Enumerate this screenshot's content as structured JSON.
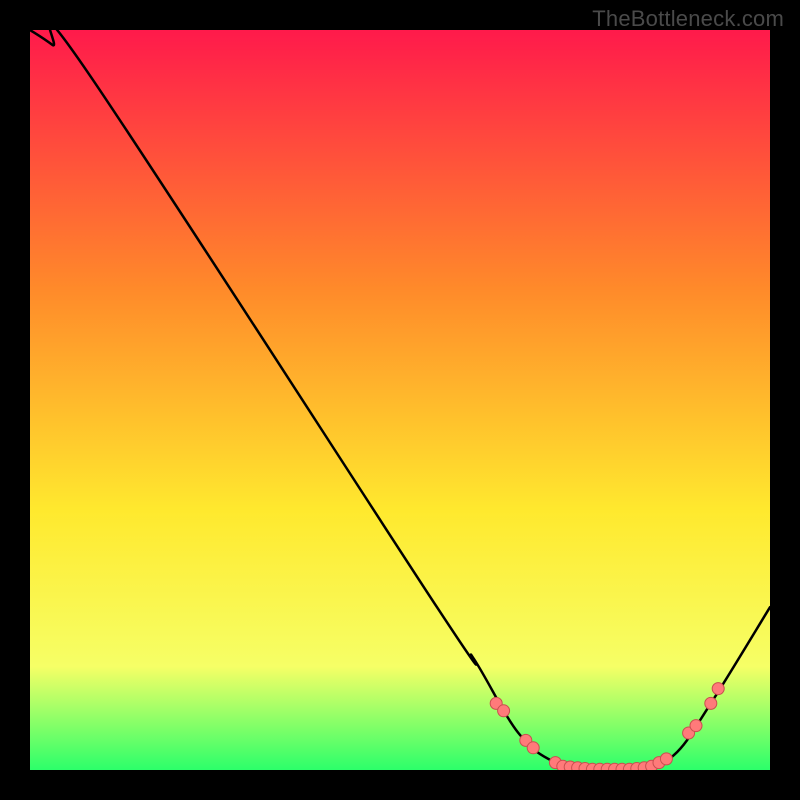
{
  "watermark": "TheBottleneck.com",
  "colors": {
    "frame": "#000000",
    "watermark_text": "#4a4a4a",
    "bg_top": "#ff1a4b",
    "bg_mid1": "#ff8a2a",
    "bg_mid2": "#ffe92e",
    "bg_mid3": "#f6ff66",
    "bg_bot": "#2cff6a",
    "curve": "#000000",
    "dot_fill": "#ff7a7a",
    "dot_stroke": "#c94f4f"
  },
  "chart_data": {
    "type": "line",
    "title": "",
    "xlabel": "",
    "ylabel": "",
    "xlim": [
      0,
      100
    ],
    "ylim": [
      0,
      100
    ],
    "grid": false,
    "curve": [
      {
        "x": 0,
        "y": 100
      },
      {
        "x": 3,
        "y": 98
      },
      {
        "x": 8,
        "y": 94
      },
      {
        "x": 55,
        "y": 22
      },
      {
        "x": 60,
        "y": 15
      },
      {
        "x": 66,
        "y": 5
      },
      {
        "x": 71,
        "y": 1
      },
      {
        "x": 76,
        "y": 0
      },
      {
        "x": 82,
        "y": 0
      },
      {
        "x": 87,
        "y": 2
      },
      {
        "x": 92,
        "y": 9
      },
      {
        "x": 100,
        "y": 22
      }
    ],
    "dots": [
      {
        "x": 63,
        "y": 9
      },
      {
        "x": 64,
        "y": 8
      },
      {
        "x": 67,
        "y": 4
      },
      {
        "x": 68,
        "y": 3
      },
      {
        "x": 71,
        "y": 1
      },
      {
        "x": 72,
        "y": 0.5
      },
      {
        "x": 73,
        "y": 0.4
      },
      {
        "x": 74,
        "y": 0.3
      },
      {
        "x": 75,
        "y": 0.2
      },
      {
        "x": 76,
        "y": 0.1
      },
      {
        "x": 77,
        "y": 0.1
      },
      {
        "x": 78,
        "y": 0.1
      },
      {
        "x": 79,
        "y": 0.1
      },
      {
        "x": 80,
        "y": 0.1
      },
      {
        "x": 81,
        "y": 0.1
      },
      {
        "x": 82,
        "y": 0.2
      },
      {
        "x": 83,
        "y": 0.3
      },
      {
        "x": 84,
        "y": 0.5
      },
      {
        "x": 85,
        "y": 1
      },
      {
        "x": 86,
        "y": 1.5
      },
      {
        "x": 89,
        "y": 5
      },
      {
        "x": 90,
        "y": 6
      },
      {
        "x": 92,
        "y": 9
      },
      {
        "x": 93,
        "y": 11
      }
    ]
  }
}
